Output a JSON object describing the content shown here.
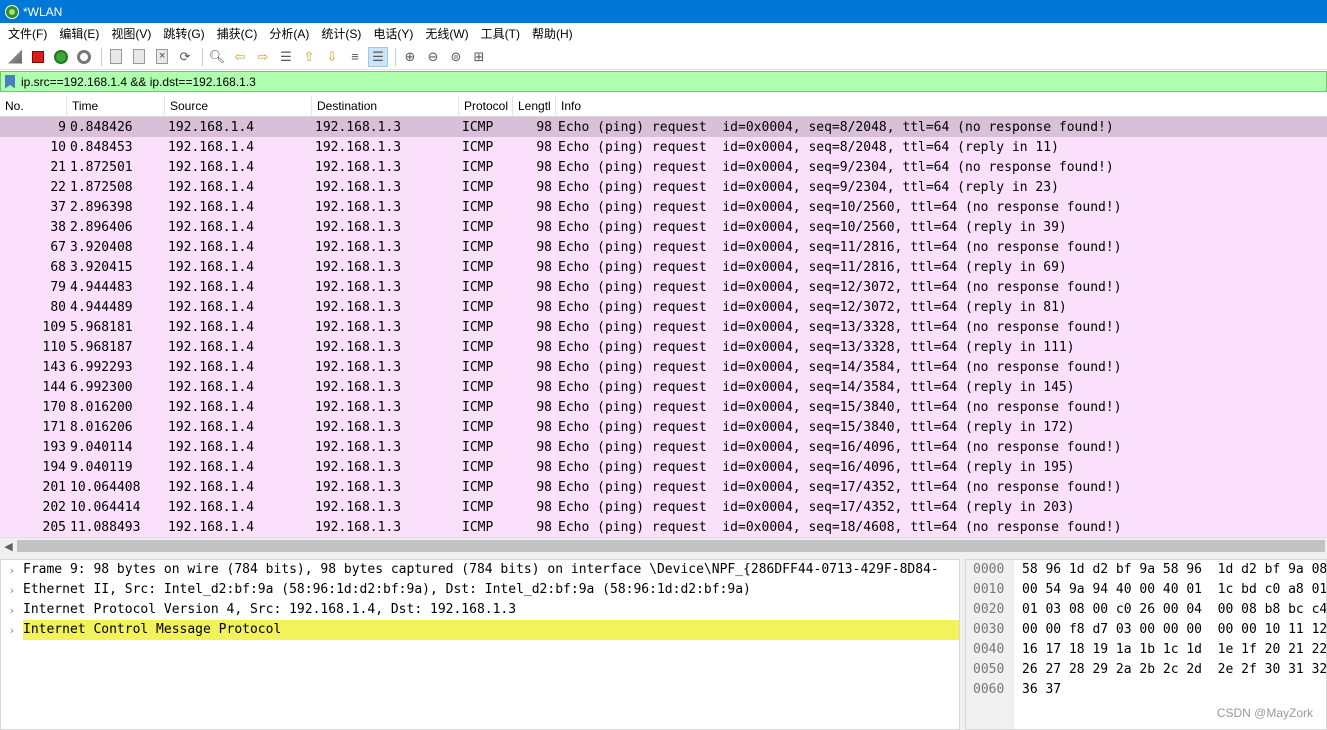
{
  "window": {
    "title": "*WLAN"
  },
  "menu": [
    "文件(F)",
    "编辑(E)",
    "视图(V)",
    "跳转(G)",
    "捕获(C)",
    "分析(A)",
    "统计(S)",
    "电话(Y)",
    "无线(W)",
    "工具(T)",
    "帮助(H)"
  ],
  "toolbar": {
    "icons": [
      "start-capture-icon",
      "stop-capture-icon",
      "restart-capture-icon",
      "capture-options-icon",
      "open-file-icon",
      "save-file-icon",
      "close-file-icon",
      "reload-file-icon",
      "find-packet-icon",
      "go-back-icon",
      "go-forward-icon",
      "go-to-packet-icon",
      "first-packet-icon",
      "last-packet-icon",
      "autoscroll-icon",
      "colorize-icon",
      "zoom-in-icon",
      "zoom-out-icon",
      "normal-size-icon",
      "resize-columns-icon"
    ]
  },
  "filter": {
    "value": "ip.src==192.168.1.4 && ip.dst==192.168.1.3"
  },
  "columns": [
    "No.",
    "Time",
    "Source",
    "Destination",
    "Protocol",
    "Lengtl",
    "Info"
  ],
  "packets": [
    {
      "no": "9",
      "time": "0.848426",
      "src": "192.168.1.4",
      "dst": "192.168.1.3",
      "proto": "ICMP",
      "len": "98",
      "info": "Echo (ping) request  id=0x0004, seq=8/2048, ttl=64 (no response found!)"
    },
    {
      "no": "10",
      "time": "0.848453",
      "src": "192.168.1.4",
      "dst": "192.168.1.3",
      "proto": "ICMP",
      "len": "98",
      "info": "Echo (ping) request  id=0x0004, seq=8/2048, ttl=64 (reply in 11)"
    },
    {
      "no": "21",
      "time": "1.872501",
      "src": "192.168.1.4",
      "dst": "192.168.1.3",
      "proto": "ICMP",
      "len": "98",
      "info": "Echo (ping) request  id=0x0004, seq=9/2304, ttl=64 (no response found!)"
    },
    {
      "no": "22",
      "time": "1.872508",
      "src": "192.168.1.4",
      "dst": "192.168.1.3",
      "proto": "ICMP",
      "len": "98",
      "info": "Echo (ping) request  id=0x0004, seq=9/2304, ttl=64 (reply in 23)"
    },
    {
      "no": "37",
      "time": "2.896398",
      "src": "192.168.1.4",
      "dst": "192.168.1.3",
      "proto": "ICMP",
      "len": "98",
      "info": "Echo (ping) request  id=0x0004, seq=10/2560, ttl=64 (no response found!)"
    },
    {
      "no": "38",
      "time": "2.896406",
      "src": "192.168.1.4",
      "dst": "192.168.1.3",
      "proto": "ICMP",
      "len": "98",
      "info": "Echo (ping) request  id=0x0004, seq=10/2560, ttl=64 (reply in 39)"
    },
    {
      "no": "67",
      "time": "3.920408",
      "src": "192.168.1.4",
      "dst": "192.168.1.3",
      "proto": "ICMP",
      "len": "98",
      "info": "Echo (ping) request  id=0x0004, seq=11/2816, ttl=64 (no response found!)"
    },
    {
      "no": "68",
      "time": "3.920415",
      "src": "192.168.1.4",
      "dst": "192.168.1.3",
      "proto": "ICMP",
      "len": "98",
      "info": "Echo (ping) request  id=0x0004, seq=11/2816, ttl=64 (reply in 69)"
    },
    {
      "no": "79",
      "time": "4.944483",
      "src": "192.168.1.4",
      "dst": "192.168.1.3",
      "proto": "ICMP",
      "len": "98",
      "info": "Echo (ping) request  id=0x0004, seq=12/3072, ttl=64 (no response found!)"
    },
    {
      "no": "80",
      "time": "4.944489",
      "src": "192.168.1.4",
      "dst": "192.168.1.3",
      "proto": "ICMP",
      "len": "98",
      "info": "Echo (ping) request  id=0x0004, seq=12/3072, ttl=64 (reply in 81)"
    },
    {
      "no": "109",
      "time": "5.968181",
      "src": "192.168.1.4",
      "dst": "192.168.1.3",
      "proto": "ICMP",
      "len": "98",
      "info": "Echo (ping) request  id=0x0004, seq=13/3328, ttl=64 (no response found!)"
    },
    {
      "no": "110",
      "time": "5.968187",
      "src": "192.168.1.4",
      "dst": "192.168.1.3",
      "proto": "ICMP",
      "len": "98",
      "info": "Echo (ping) request  id=0x0004, seq=13/3328, ttl=64 (reply in 111)"
    },
    {
      "no": "143",
      "time": "6.992293",
      "src": "192.168.1.4",
      "dst": "192.168.1.3",
      "proto": "ICMP",
      "len": "98",
      "info": "Echo (ping) request  id=0x0004, seq=14/3584, ttl=64 (no response found!)"
    },
    {
      "no": "144",
      "time": "6.992300",
      "src": "192.168.1.4",
      "dst": "192.168.1.3",
      "proto": "ICMP",
      "len": "98",
      "info": "Echo (ping) request  id=0x0004, seq=14/3584, ttl=64 (reply in 145)"
    },
    {
      "no": "170",
      "time": "8.016200",
      "src": "192.168.1.4",
      "dst": "192.168.1.3",
      "proto": "ICMP",
      "len": "98",
      "info": "Echo (ping) request  id=0x0004, seq=15/3840, ttl=64 (no response found!)"
    },
    {
      "no": "171",
      "time": "8.016206",
      "src": "192.168.1.4",
      "dst": "192.168.1.3",
      "proto": "ICMP",
      "len": "98",
      "info": "Echo (ping) request  id=0x0004, seq=15/3840, ttl=64 (reply in 172)"
    },
    {
      "no": "193",
      "time": "9.040114",
      "src": "192.168.1.4",
      "dst": "192.168.1.3",
      "proto": "ICMP",
      "len": "98",
      "info": "Echo (ping) request  id=0x0004, seq=16/4096, ttl=64 (no response found!)"
    },
    {
      "no": "194",
      "time": "9.040119",
      "src": "192.168.1.4",
      "dst": "192.168.1.3",
      "proto": "ICMP",
      "len": "98",
      "info": "Echo (ping) request  id=0x0004, seq=16/4096, ttl=64 (reply in 195)"
    },
    {
      "no": "201",
      "time": "10.064408",
      "src": "192.168.1.4",
      "dst": "192.168.1.3",
      "proto": "ICMP",
      "len": "98",
      "info": "Echo (ping) request  id=0x0004, seq=17/4352, ttl=64 (no response found!)"
    },
    {
      "no": "202",
      "time": "10.064414",
      "src": "192.168.1.4",
      "dst": "192.168.1.3",
      "proto": "ICMP",
      "len": "98",
      "info": "Echo (ping) request  id=0x0004, seq=17/4352, ttl=64 (reply in 203)"
    },
    {
      "no": "205",
      "time": "11.088493",
      "src": "192.168.1.4",
      "dst": "192.168.1.3",
      "proto": "ICMP",
      "len": "98",
      "info": "Echo (ping) request  id=0x0004, seq=18/4608, ttl=64 (no response found!)"
    }
  ],
  "selected_packet": "9",
  "details": [
    {
      "text": "Frame 9: 98 bytes on wire (784 bits), 98 bytes captured (784 bits) on interface \\Device\\NPF_{286DFF44-0713-429F-8D84-",
      "highlighted": false
    },
    {
      "text": "Ethernet II, Src: Intel_d2:bf:9a (58:96:1d:d2:bf:9a), Dst: Intel_d2:bf:9a (58:96:1d:d2:bf:9a)",
      "highlighted": false
    },
    {
      "text": "Internet Protocol Version 4, Src: 192.168.1.4, Dst: 192.168.1.3",
      "highlighted": false
    },
    {
      "text": "Internet Control Message Protocol",
      "highlighted": true
    }
  ],
  "bytes": [
    {
      "offset": "0000",
      "hex": "58 96 1d d2 bf 9a 58 96  1d d2 bf 9a 08"
    },
    {
      "offset": "0010",
      "hex": "00 54 9a 94 40 00 40 01  1c bd c0 a8 01"
    },
    {
      "offset": "0020",
      "hex": "01 03 08 00 c0 26 00 04  00 08 b8 bc c4"
    },
    {
      "offset": "0030",
      "hex": "00 00 f8 d7 03 00 00 00  00 00 10 11 12"
    },
    {
      "offset": "0040",
      "hex": "16 17 18 19 1a 1b 1c 1d  1e 1f 20 21 22"
    },
    {
      "offset": "0050",
      "hex": "26 27 28 29 2a 2b 2c 2d  2e 2f 30 31 32"
    },
    {
      "offset": "0060",
      "hex": "36 37"
    }
  ],
  "watermark": "CSDN @MayZork",
  "colors": {
    "titlebar": "#0078d7",
    "filter_bg": "#afffaf",
    "row_bg": "#fae0fa",
    "row_selected": "#d8c0d8",
    "detail_highlight": "#f2f25a"
  }
}
